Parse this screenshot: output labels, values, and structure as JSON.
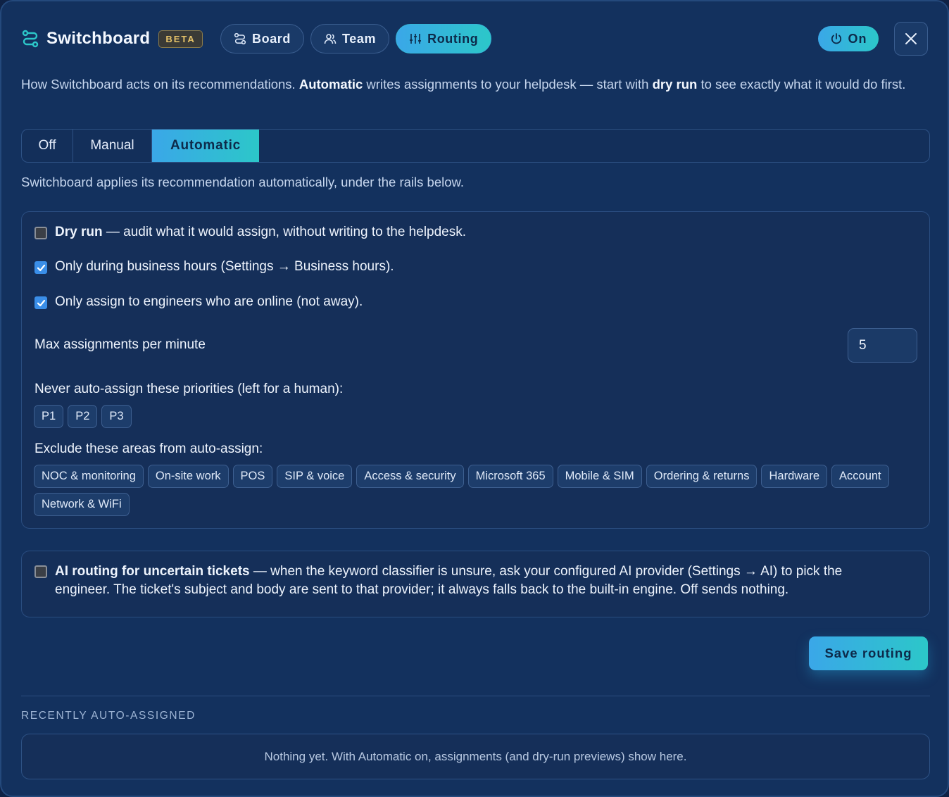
{
  "header": {
    "app_name": "Switchboard",
    "badge": "BETA",
    "tabs": [
      {
        "label": "Board",
        "icon": "route-icon",
        "active": false
      },
      {
        "label": "Team",
        "icon": "users-icon",
        "active": false
      },
      {
        "label": "Routing",
        "icon": "sliders-icon",
        "active": true
      }
    ],
    "power_label": "On",
    "close_icon": "close-icon"
  },
  "intro": {
    "part1": "How Switchboard acts on its recommendations. ",
    "bold1": "Automatic",
    "part2": " writes assignments to your helpdesk — start with ",
    "bold2": "dry run",
    "part3": " to see exactly what it would do first."
  },
  "mode_segment": {
    "options": [
      "Off",
      "Manual",
      "Automatic"
    ],
    "selected": "Automatic"
  },
  "mode_note": "Switchboard applies its recommendation automatically, under the rails below.",
  "rails": {
    "dry_run": {
      "bold": "Dry run",
      "text": " — audit what it would assign, without writing to the helpdesk.",
      "checked": false
    },
    "business_hours": {
      "text": "Only during business hours (Settings → Business hours).",
      "checked": true
    },
    "online_only": {
      "text": "Only assign to engineers who are online (not away).",
      "checked": true
    },
    "max_label": "Max assignments per minute",
    "max_value": "5",
    "priorities_label": "Never auto-assign these priorities (left for a human):",
    "priorities": [
      "P1",
      "P2",
      "P3"
    ],
    "areas_label": "Exclude these areas from auto-assign:",
    "areas": [
      "NOC & monitoring",
      "On-site work",
      "POS",
      "SIP & voice",
      "Access & security",
      "Microsoft 365",
      "Mobile & SIM",
      "Ordering & returns",
      "Hardware",
      "Account",
      "Network & WiFi"
    ]
  },
  "ai_routing": {
    "bold": "AI routing for uncertain tickets",
    "text": " — when the keyword classifier is unsure, ask your configured AI provider (Settings → AI) to pick the engineer. The ticket's subject and body are sent to that provider; it always falls back to the built-in engine. Off sends nothing.",
    "checked": false
  },
  "save_label": "Save routing",
  "recent": {
    "title": "RECENTLY AUTO-ASSIGNED",
    "empty_text": "Nothing yet. With Automatic on, assignments (and dry-run previews) show here."
  },
  "colors": {
    "accent_start": "#3aa7e8",
    "accent_end": "#2cc7c9",
    "panel_bg": "#13315e",
    "beta": "#e6c36a"
  }
}
